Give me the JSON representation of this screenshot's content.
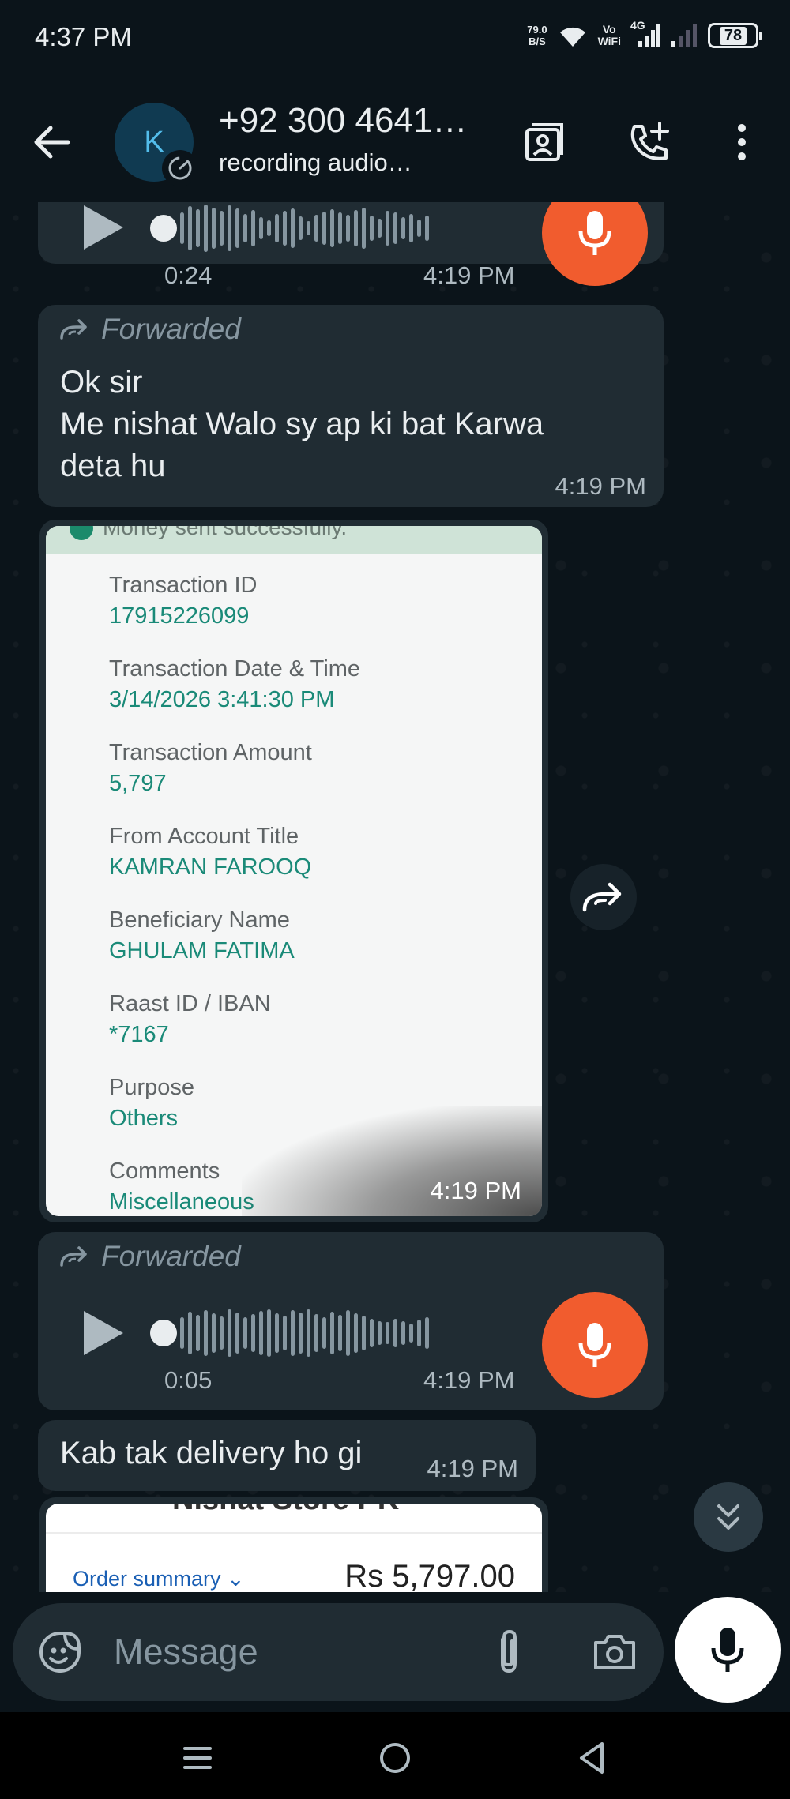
{
  "status_bar": {
    "time": "4:37 PM",
    "net_speed_value": "79.0",
    "net_speed_unit": "B/S",
    "vo_wifi_top": "Vo",
    "vo_wifi_bottom": "WiFi",
    "network": "4G",
    "battery": "78"
  },
  "header": {
    "avatar_letter": "K",
    "contact_name": "+92 300 4641…",
    "contact_status": "recording audio…",
    "icons": [
      "back-arrow-icon",
      "contacts-book-icon",
      "add-call-icon",
      "more-vert-icon"
    ]
  },
  "messages": {
    "voice1": {
      "duration": "0:24",
      "time": "4:19 PM"
    },
    "text1": {
      "forwarded_label": "Forwarded",
      "lines": [
        "Ok sir",
        "Me nishat Walo sy ap ki bat Karwa",
        "deta hu"
      ],
      "time": "4:19 PM"
    },
    "receipt": {
      "top_text": "Money sent successfully.",
      "fields": [
        {
          "label": "Transaction ID",
          "value": "17915226099"
        },
        {
          "label": "Transaction Date & Time",
          "value": "3/14/2026 3:41:30 PM"
        },
        {
          "label": "Transaction Amount",
          "value": "5,797"
        },
        {
          "label": "From Account Title",
          "value": "KAMRAN FAROOQ"
        },
        {
          "label": "Beneficiary Name",
          "value": "GHULAM FATIMA"
        },
        {
          "label": "Raast ID / IBAN",
          "value": "*7167"
        },
        {
          "label": "Purpose",
          "value": "Others"
        },
        {
          "label": "Comments",
          "value": "Miscellaneous"
        }
      ],
      "time": "4:19 PM"
    },
    "voice2": {
      "forwarded_label": "Forwarded",
      "duration": "0:05",
      "time": "4:19 PM"
    },
    "text2": {
      "text": "Kab tak delivery ho gi",
      "time": "4:19 PM"
    },
    "order": {
      "title": "Nishat Store PK",
      "summary_label": "Order summary ⌄",
      "amount": "Rs 5,797.00"
    }
  },
  "composer": {
    "placeholder": "Message"
  },
  "colors": {
    "background": "#0b141a",
    "bubble": "#202c33",
    "mic_accent": "#f15c2e",
    "receipt_value": "#1a8a78"
  }
}
